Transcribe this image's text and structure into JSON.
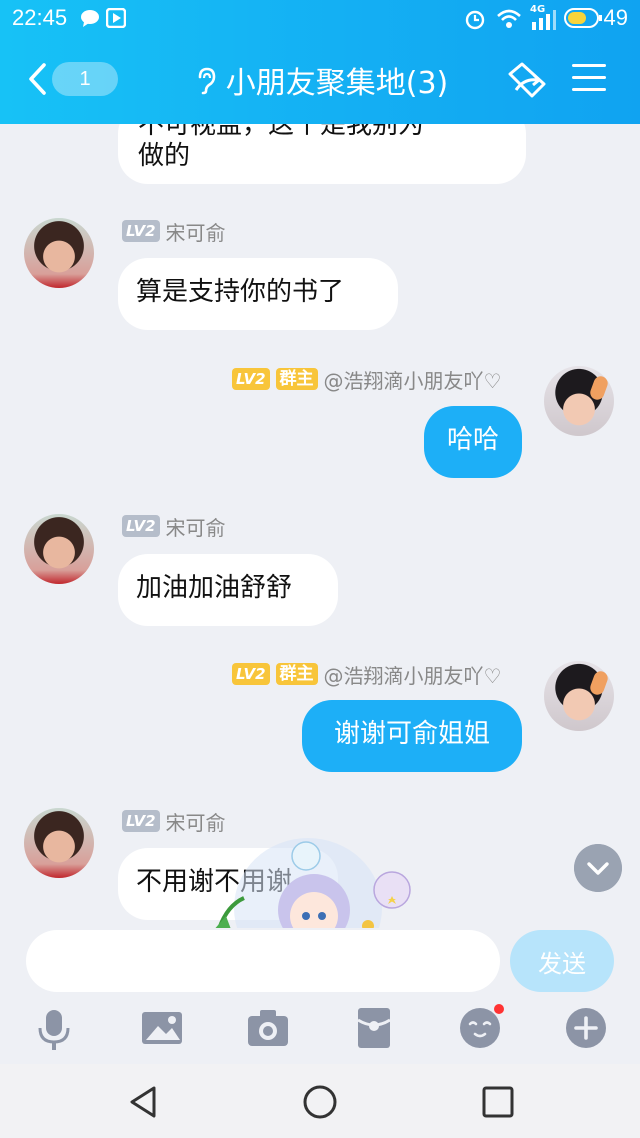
{
  "status_bar": {
    "time": "22:45",
    "network": "4G",
    "battery_pct": "49",
    "icons": [
      "message-icon",
      "media-icon",
      "alarm-icon",
      "wifi-icon",
      "signal-icon",
      "battery-icon"
    ]
  },
  "header": {
    "back_count": "1",
    "title": "小朋友聚集地(3)",
    "icons": [
      "back-chevron-icon",
      "listen-ear-icon",
      "share-icon",
      "menu-icon"
    ],
    "colors": {
      "gradient_start": "#17c2f6",
      "gradient_end": "#10a3f1"
    }
  },
  "messages": [
    {
      "from": "other",
      "name": "",
      "level": "",
      "text_cut": "不可视监，这个是我别为",
      "text": "做的",
      "partial": true
    },
    {
      "from": "other",
      "level": "LV2",
      "name": "宋可俞",
      "text": "算是支持你的书了"
    },
    {
      "from": "self",
      "level": "LV2",
      "role": "群主",
      "name": "@浩翔滴小朋友吖♡",
      "text": "哈哈"
    },
    {
      "from": "other",
      "level": "LV2",
      "name": "宋可俞",
      "text": "加油加油舒舒"
    },
    {
      "from": "self",
      "level": "LV2",
      "role": "群主",
      "name": "@浩翔滴小朋友吖♡",
      "text": "谢谢可俞姐姐"
    },
    {
      "from": "other",
      "level": "LV2",
      "name": "宋可俞",
      "text": "不用谢不用谢"
    }
  ],
  "input": {
    "placeholder": "",
    "value": "",
    "send_label": "发送"
  },
  "toolbar": [
    "microphone-icon",
    "image-icon",
    "camera-icon",
    "red-packet-icon",
    "emoji-icon",
    "plus-icon"
  ],
  "system_nav": [
    "back-triangle-icon",
    "home-circle-icon",
    "recents-square-icon"
  ],
  "colors": {
    "bubble_blue": "#1daff7",
    "chat_bg": "#eef0f5",
    "send_disabled": "#b7e4fb"
  }
}
